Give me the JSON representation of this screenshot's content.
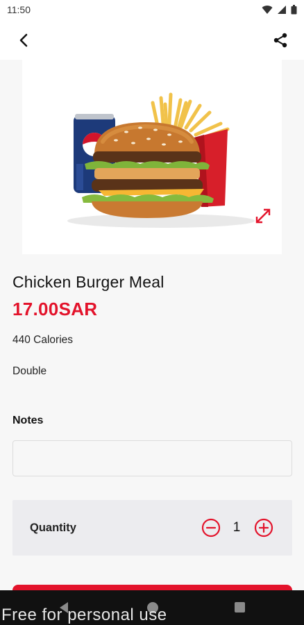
{
  "status_bar": {
    "time": "11:50"
  },
  "product": {
    "name": "Chicken Burger Meal",
    "price": "17.00SAR",
    "calories": "440 Calories",
    "variant": "Double"
  },
  "notes": {
    "label": "Notes",
    "value": "",
    "placeholder": ""
  },
  "quantity": {
    "label": "Quantity",
    "value": "1"
  },
  "watermark": "Free for personal use",
  "colors": {
    "accent": "#e3132b",
    "background": "#f7f7f7",
    "qty_panel": "#ececef"
  },
  "icons": {
    "back": "back-arrow-icon",
    "share": "share-icon",
    "expand": "expand-icon",
    "minus": "minus-circle-icon",
    "plus": "plus-circle-icon"
  }
}
